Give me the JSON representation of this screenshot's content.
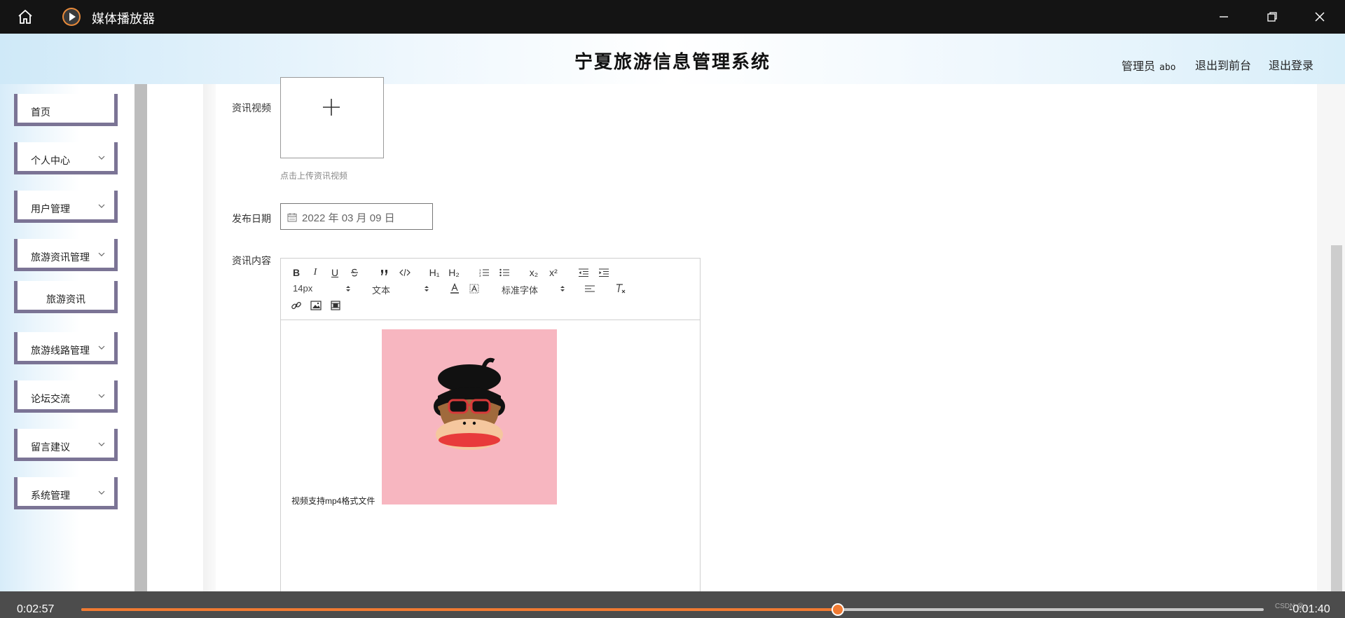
{
  "player": {
    "title": "媒体播放器",
    "elapsed": "0:02:57",
    "remaining": "-0:01:40",
    "progress": 0.64,
    "accent": "#f07a32",
    "watermark": "CSDN @..."
  },
  "header": {
    "system_title": "宁夏旅游信息管理系统",
    "user_role": "管理员",
    "username": "abo",
    "front_link": "退出到前台",
    "logout_link": "退出登录"
  },
  "sidebar": {
    "items": [
      {
        "label": "首页",
        "expandable": false
      },
      {
        "label": "个人中心",
        "expandable": true
      },
      {
        "label": "用户管理",
        "expandable": true
      },
      {
        "label": "旅游资讯管理",
        "expandable": true
      },
      {
        "label": "旅游资讯",
        "expandable": false
      },
      {
        "label": "旅游线路管理",
        "expandable": true
      },
      {
        "label": "论坛交流",
        "expandable": true
      },
      {
        "label": "留言建议",
        "expandable": true
      },
      {
        "label": "系统管理",
        "expandable": true
      }
    ],
    "border_color": "#7b7495"
  },
  "form": {
    "video_label": "资讯视频",
    "video_hint": "点击上传资讯视频",
    "date_label": "发布日期",
    "date_value": "2022 年 03 月 09 日",
    "content_label": "资讯内容"
  },
  "editor": {
    "toolbar": {
      "bold": "B",
      "italic": "I",
      "underline": "U",
      "h1": "H₁",
      "h2": "H₂",
      "subscript": "x₂",
      "superscript": "x²",
      "size": "14px",
      "header": "文本",
      "font": "标准字体"
    },
    "body_text": "视频支持mp4格式文件"
  }
}
